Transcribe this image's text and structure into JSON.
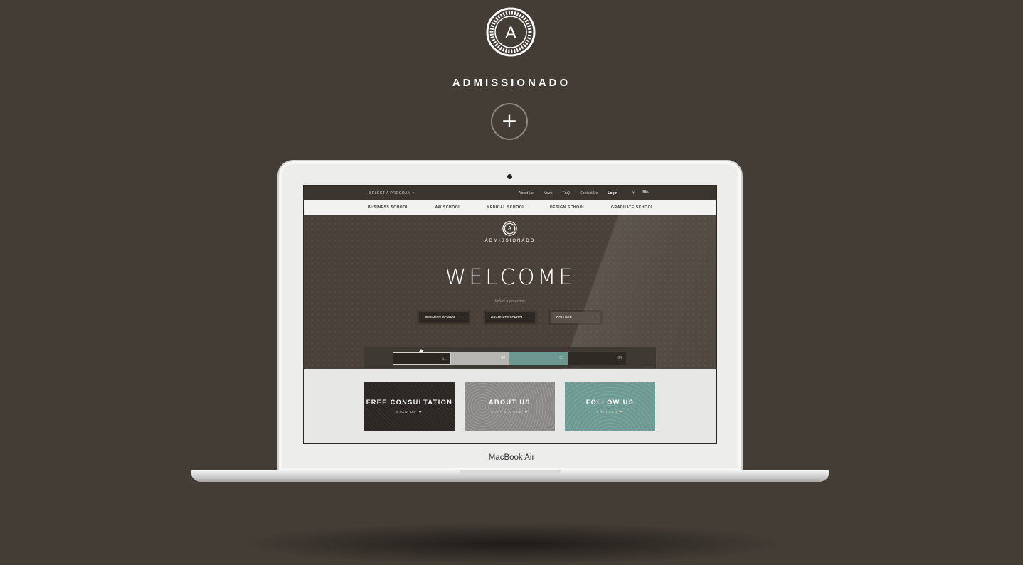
{
  "brand": {
    "name": "ADMISSIONADO",
    "logo_letter": "A"
  },
  "expand_button": {
    "symbol": "+"
  },
  "device": {
    "label": "MacBook Air"
  },
  "site": {
    "topbar": {
      "select_program": "SELECT A PROGRAM",
      "links": [
        "About Us",
        "News",
        "FAQ",
        "Contact Us"
      ],
      "login": "Login",
      "search_icon": "search-icon",
      "cart_icon": "cart-icon"
    },
    "nav": [
      "BUSINESS SCHOOL",
      "LAW SCHOOL",
      "MEDICAL SCHOOL",
      "DESIGN SCHOOL",
      "GRADUATE SCHOOL"
    ],
    "hero": {
      "brand": "ADMISSIONADO",
      "welcome": "WELCOME",
      "select_label": "Select a program:",
      "programs": [
        "BUSINESS SCHOOL",
        "GRADUATE SCHOOL",
        "COLLEGE"
      ]
    },
    "slider_tabs": [
      "01",
      "02",
      "03",
      "04"
    ],
    "cards": [
      {
        "title": "FREE CONSULTATION",
        "link": "SIGN UP ➡"
      },
      {
        "title": "ABOUT US",
        "link": "LEARN MORE ➡"
      },
      {
        "title": "FOLLOW US",
        "link": "TWITTER ➡"
      }
    ]
  },
  "colors": {
    "background": "#443d36",
    "accent_teal": "#6e9a94",
    "dark": "#2c2623"
  }
}
